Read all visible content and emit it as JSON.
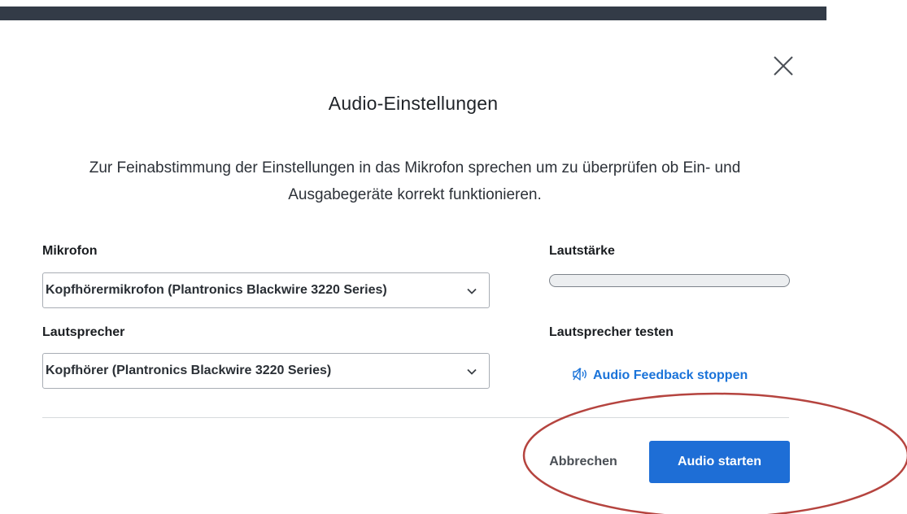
{
  "dialog": {
    "title": "Audio-Einstellungen",
    "description": "Zur Feinabstimmung der Einstellungen in das Mikrofon sprechen um zu überprüfen ob Ein- und Ausgabegeräte korrekt funktionieren.",
    "close_icon": "close-icon"
  },
  "microphone": {
    "label": "Mikrofon",
    "selected": "Kopfhörermikrofon (Plantronics Blackwire 3220 Series)",
    "chevron_icon": "chevron-down-icon"
  },
  "volume": {
    "label": "Lautstärke",
    "level": 0
  },
  "speaker": {
    "label": "Lautsprecher",
    "selected": "Kopfhörer (Plantronics Blackwire 3220 Series)",
    "chevron_icon": "chevron-down-icon"
  },
  "speaker_test": {
    "label": "Lautsprecher testen",
    "link_label": "Audio Feedback stoppen",
    "link_icon": "speaker-icon"
  },
  "actions": {
    "cancel_label": "Abbrechen",
    "start_label": "Audio starten"
  },
  "colors": {
    "top_bar": "#333b47",
    "primary": "#1e6ed6",
    "link": "#1a73d9",
    "annotation_circle": "#b5443f"
  }
}
